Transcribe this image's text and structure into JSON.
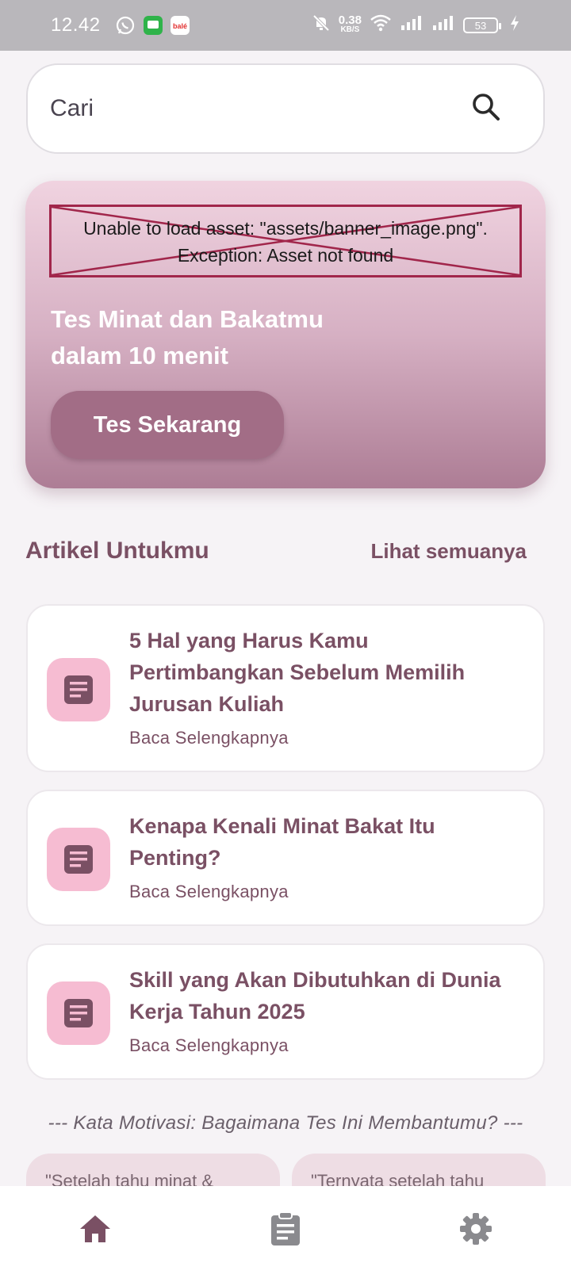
{
  "status_bar": {
    "time": "12.42",
    "net_speed_value": "0.38",
    "net_speed_unit": "KB/S",
    "battery": "53"
  },
  "search": {
    "placeholder": "Cari",
    "icon": "search-icon"
  },
  "banner": {
    "error_line1": "Unable to load asset: \"assets/banner_image.png\".",
    "error_line2": "Exception: Asset not found",
    "title_line1": "Tes Minat dan Bakatmu",
    "title_line2": "dalam 10 menit",
    "button_label": "Tes Sekarang"
  },
  "articles_section": {
    "title": "Artikel Untukmu",
    "see_all": "Lihat semuanya",
    "items": [
      {
        "title": "5 Hal yang Harus Kamu Pertimbangkan Sebelum Memilih Jurusan Kuliah",
        "link": "Baca Selengkapnya",
        "icon": "article-icon"
      },
      {
        "title": "Kenapa Kenali Minat Bakat Itu Penting?",
        "link": "Baca Selengkapnya",
        "icon": "article-icon"
      },
      {
        "title": "Skill yang Akan Dibutuhkan di Dunia Kerja Tahun 2025",
        "link": "Baca Selengkapnya",
        "icon": "article-icon"
      }
    ]
  },
  "motivation": {
    "heading": "--- Kata Motivasi: Bagaimana Tes Ini Membantumu? ---",
    "quotes": [
      "\"Setelah tahu minat &",
      "\"Ternyata setelah tahu"
    ]
  },
  "bottom_nav": {
    "items": [
      {
        "icon": "home-icon",
        "active": true
      },
      {
        "icon": "clipboard-icon",
        "active": false
      },
      {
        "icon": "gear-icon",
        "active": false
      }
    ]
  },
  "colors": {
    "primary": "#7a5064",
    "banner_button": "#a26d86",
    "icon_bg": "#f6bcd2",
    "inactive_nav": "#8a8a8e"
  }
}
